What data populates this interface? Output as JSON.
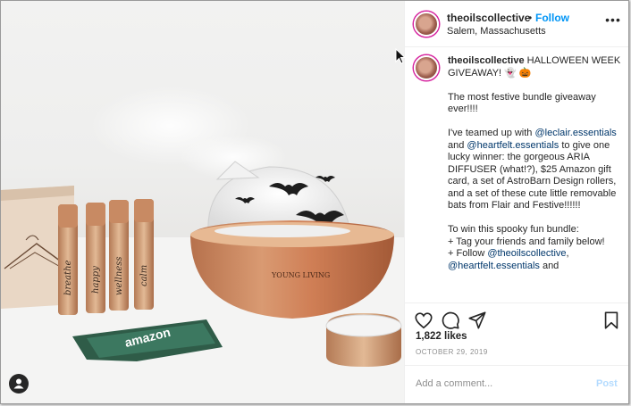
{
  "post": {
    "username": "theoilscollective",
    "separator": "•",
    "follow_label": "Follow",
    "location": "Salem, Massachusetts",
    "more_label": "•••",
    "caption": {
      "username": "theoilscollective",
      "line1": " HALLOWEEN WEEK GIVEAWAY! 👻 🎃",
      "line2": "The most festive bundle giveaway ever!!!!",
      "line3a": "I've teamed up with ",
      "mention1": "@leclair.essentials",
      "line3b": " and ",
      "mention2": "@heartfelt.essentials",
      "line3c": " to give one lucky winner: the gorgeous ARIA DIFFUSER (what!?), $25 Amazon gift card, a set of AstroBarn Design rollers, and a set of these cute little removable bats from Flair and Festive!!!!!!",
      "line4": "To win this spooky fun bundle:",
      "line5": "+ Tag your friends and family below!",
      "line6a": "+ Follow ",
      "mention3": "@theoilscollective",
      "line6b": ",",
      "mention4": "@heartfelt.essentials",
      "line6c": " and"
    },
    "likes": "1,822 likes",
    "date": "OCTOBER 29, 2019",
    "comment_placeholder": "Add a comment...",
    "post_label": "Post"
  },
  "icons": {
    "like": "heart-icon",
    "comment": "comment-icon",
    "share": "share-icon",
    "save": "bookmark-icon",
    "more": "more-icon",
    "user": "user-icon"
  },
  "photo": {
    "roller_labels": [
      "breathe",
      "happy",
      "wellness",
      "calm"
    ],
    "diffuser_brand": "YOUNG LIVING",
    "gift_card": "amazon"
  },
  "colors": {
    "follow": "#0095f6",
    "mention": "#00376b",
    "muted": "#8e8e8e",
    "post_disabled": "#b3dbff"
  }
}
